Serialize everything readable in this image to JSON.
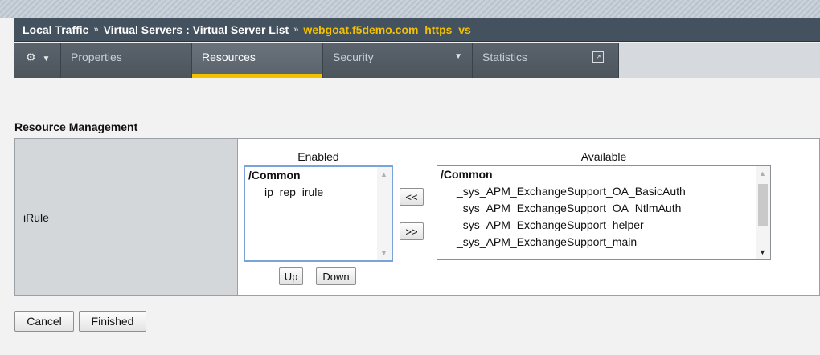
{
  "breadcrumb": {
    "part1": "Local Traffic",
    "part2": "Virtual Servers : Virtual Server List",
    "current": "webgoat.f5demo.com_https_vs"
  },
  "tabs": {
    "properties": "Properties",
    "resources": "Resources",
    "security": "Security",
    "statistics": "Statistics"
  },
  "section": {
    "title": "Resource Management",
    "row_label": "iRule"
  },
  "enabled": {
    "header": "Enabled",
    "group": "/Common",
    "items": [
      "ip_rep_irule"
    ]
  },
  "available": {
    "header": "Available",
    "group": "/Common",
    "items": [
      "_sys_APM_ExchangeSupport_OA_BasicAuth",
      "_sys_APM_ExchangeSupport_OA_NtlmAuth",
      "_sys_APM_ExchangeSupport_helper",
      "_sys_APM_ExchangeSupport_main"
    ]
  },
  "buttons": {
    "move_left": "<<",
    "move_right": ">>",
    "up": "Up",
    "down": "Down",
    "cancel": "Cancel",
    "finished": "Finished"
  },
  "colors": {
    "header_bg": "#44515f",
    "accent": "#f2c200",
    "tab_bg": "#555e67",
    "label_cell": "#d4d7da"
  }
}
